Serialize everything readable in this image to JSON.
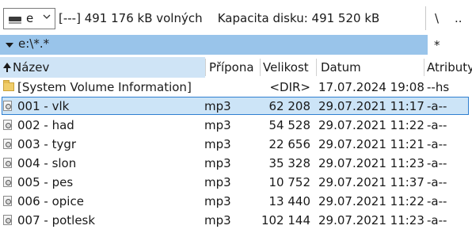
{
  "drivebar": {
    "drive_letter": "e",
    "free_label": "[---]  491 176 kB volných",
    "capacity_label": "Kapacita disku: 491 520 kB",
    "root_button": "\\",
    "up_button": ".."
  },
  "pathbar": {
    "path": "e:\\*.*",
    "filter": "*"
  },
  "columns": {
    "name": "Název",
    "ext": "Přípona",
    "size": "Velikost",
    "date": "Datum",
    "attr": "Atributy"
  },
  "files": [
    {
      "name": "[System Volume Information]",
      "ext": "",
      "size": "<DIR>",
      "date": "17.07.2024 19:08",
      "attr": "--hs",
      "icon": "folder-icon"
    },
    {
      "name": "001 - vlk",
      "ext": "mp3",
      "size": "62 208",
      "date": "29.07.2021 11:17",
      "attr": "-a--",
      "icon": "audio-file-icon"
    },
    {
      "name": "002 - had",
      "ext": "mp3",
      "size": "54 528",
      "date": "29.07.2021 11:22",
      "attr": "-a--",
      "icon": "audio-file-icon"
    },
    {
      "name": "003 - tygr",
      "ext": "mp3",
      "size": "22 656",
      "date": "29.07.2021 11:21",
      "attr": "-a--",
      "icon": "audio-file-icon"
    },
    {
      "name": "004 - slon",
      "ext": "mp3",
      "size": "35 328",
      "date": "29.07.2021 11:23",
      "attr": "-a--",
      "icon": "audio-file-icon"
    },
    {
      "name": "005 - pes",
      "ext": "mp3",
      "size": "10 752",
      "date": "29.07.2021 11:37",
      "attr": "-a--",
      "icon": "audio-file-icon"
    },
    {
      "name": "006 - opice",
      "ext": "mp3",
      "size": "13 440",
      "date": "29.07.2021 11:22",
      "attr": "-a--",
      "icon": "audio-file-icon"
    },
    {
      "name": "007 - potlesk",
      "ext": "mp3",
      "size": "102 144",
      "date": "29.07.2021 11:23",
      "attr": "-a--",
      "icon": "audio-file-icon"
    }
  ],
  "colors": {
    "path_bar": "#99c4ea",
    "sorted_header": "#cfe4f6",
    "selection_fill": "#cce4f7",
    "selection_border": "#2f7fd0"
  }
}
